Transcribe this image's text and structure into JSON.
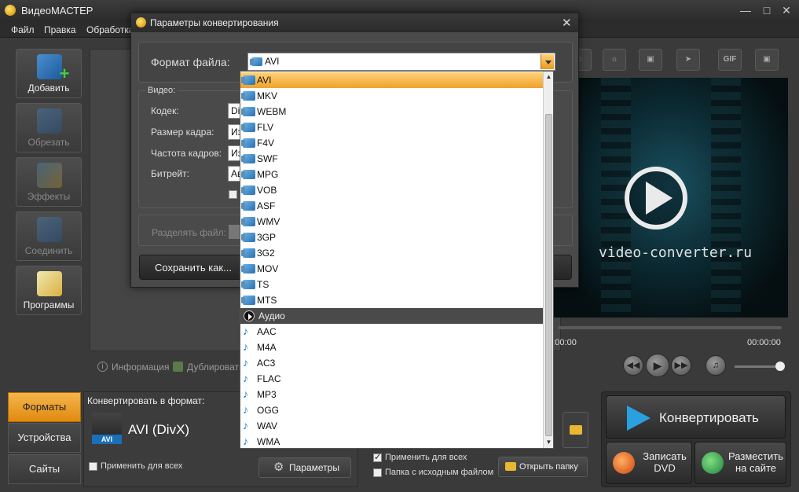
{
  "window": {
    "title": "ВидеоМАСТЕР"
  },
  "menu": [
    "Файл",
    "Правка",
    "Обработка"
  ],
  "toolbar": {
    "add": "Добавить",
    "cut": "Обрезать",
    "effects": "Эффекты",
    "join": "Соединить",
    "programs": "Программы"
  },
  "top_icons": {
    "gif": "GIF"
  },
  "preview": {
    "site": "video-converter.ru",
    "time_start": "00:00:00",
    "time_end": "00:00:00"
  },
  "infobar": {
    "info": "Информация",
    "dub": "Дублировать"
  },
  "tabs": {
    "formats": "Форматы",
    "devices": "Устройства",
    "sites": "Сайты"
  },
  "format_panel": {
    "label": "Конвертировать в формат:",
    "format_name": "AVI (DivX)",
    "badge": "AVI",
    "apply_all": "Применить для всех",
    "params": "Параметры"
  },
  "output": {
    "apply_all": "Применить для всех",
    "source_folder": "Папка с исходным файлом",
    "open_folder": "Открыть папку"
  },
  "convert": {
    "main": "Конвертировать",
    "dvd": "Записать DVD",
    "site": "Разместить на сайте"
  },
  "dialog": {
    "title": "Параметры конвертирования",
    "format_label": "Формат файла:",
    "format_value": "AVI",
    "video_legend": "Видео:",
    "codec_label": "Кодек:",
    "codec_value": "Di",
    "framesize_label": "Размер кадра:",
    "framesize_value": "Из",
    "fps_label": "Частота кадров:",
    "fps_value": "Из",
    "bitrate_label": "Битрейт:",
    "bitrate_value": "Ав",
    "split_label": "Разделять файл:",
    "save_as": "Сохранить как..."
  },
  "dropdown": {
    "video_items": [
      "AVI",
      "MKV",
      "WEBM",
      "FLV",
      "F4V",
      "SWF",
      "MPG",
      "VOB",
      "ASF",
      "WMV",
      "3GP",
      "3G2",
      "MOV",
      "TS",
      "MTS"
    ],
    "group": "Аудио",
    "audio_items": [
      "AAC",
      "M4A",
      "AC3",
      "FLAC",
      "MP3",
      "OGG",
      "WAV",
      "WMA"
    ],
    "selected": "AVI"
  },
  "colors": {
    "accent": "#f0a22a",
    "background": "#3a3a3a",
    "play_blue": "#2aa0e0"
  }
}
